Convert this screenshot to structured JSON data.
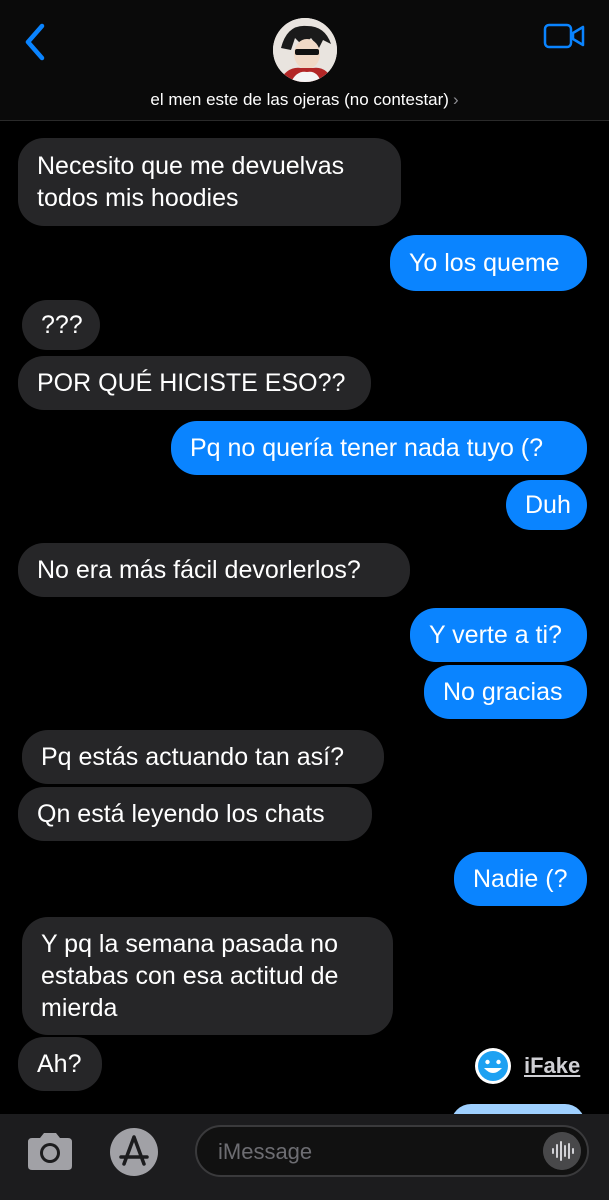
{
  "header": {
    "contact_name": "el men este de las ojeras (no contestar)",
    "chevron": "›"
  },
  "messages": [
    {
      "side": "in",
      "text": "Necesito que me devuelvas\ntodos mis hoodies"
    },
    {
      "side": "out",
      "text": "Yo los queme"
    },
    {
      "side": "in",
      "text": "???"
    },
    {
      "side": "in",
      "text": "POR QUÉ HICISTE ESO??"
    },
    {
      "side": "out",
      "text": "Pq no quería tener nada tuyo (?"
    },
    {
      "side": "out",
      "text": "Duh"
    },
    {
      "side": "in",
      "text": "No era más fácil devorlerlos?"
    },
    {
      "side": "out",
      "text": "Y verte a ti?"
    },
    {
      "side": "out",
      "text": "No gracias"
    },
    {
      "side": "in",
      "text": "Pq estás actuando tan así?"
    },
    {
      "side": "in",
      "text": "Qn está leyendo los chats"
    },
    {
      "side": "out",
      "text": "Nadie (?"
    },
    {
      "side": "in",
      "text": "Y pq la semana pasada no\nestabas con esa actitud de\nmierda"
    },
    {
      "side": "in",
      "text": "Ah?"
    }
  ],
  "watermark": {
    "text": "iFake"
  },
  "input": {
    "placeholder": "iMessage"
  },
  "colors": {
    "incoming_bubble": "#262628",
    "outgoing_bubble": "#0a84ff",
    "accent": "#0a84ff",
    "background": "#000000"
  },
  "icons": [
    "back-icon",
    "video-call-icon",
    "camera-icon",
    "app-store-icon",
    "voice-message-icon",
    "ifake-logo-icon"
  ]
}
